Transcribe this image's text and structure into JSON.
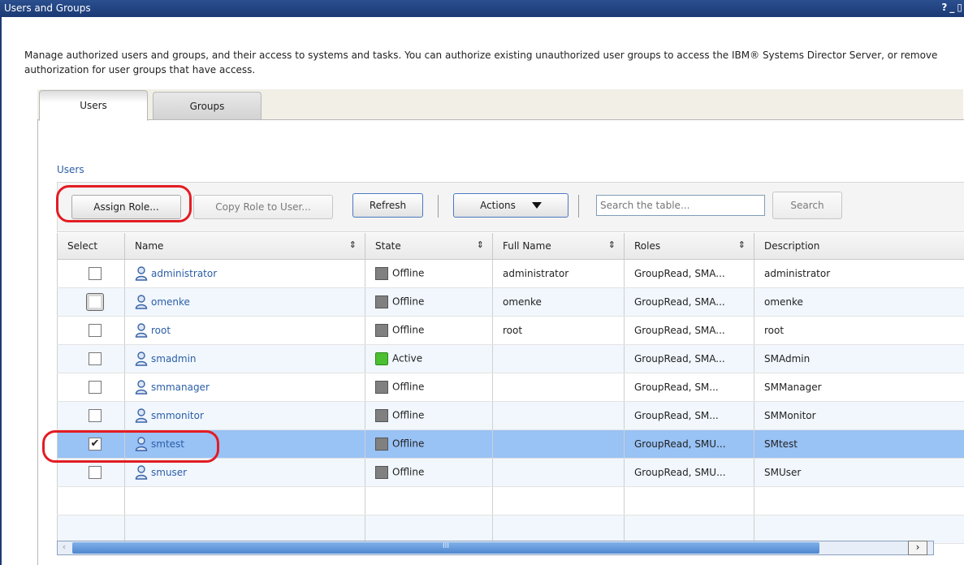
{
  "window": {
    "title": "Users and Groups",
    "help": "?",
    "minimize": "_"
  },
  "description": "Manage authorized users and groups, and their access to systems and tasks. You can authorize existing unauthorized user groups to access the IBM® Systems Director Server, or remove authorization for user groups that have access.",
  "tabs": [
    {
      "label": "Users"
    },
    {
      "label": "Groups"
    }
  ],
  "section_label": "Users",
  "toolbar": {
    "assign_role": "Assign Role...",
    "copy_role": "Copy Role to User...",
    "refresh": "Refresh",
    "actions": "Actions",
    "search_placeholder": "Search the table...",
    "search": "Search"
  },
  "table": {
    "columns": [
      "Select",
      "Name",
      "State",
      "Full Name",
      "Roles",
      "Description"
    ],
    "rows": [
      {
        "name": "administrator",
        "state": "Offline",
        "full_name": "administrator",
        "roles": "GroupRead, SMA...",
        "description": "administrator",
        "checked": "",
        "status": "offline"
      },
      {
        "name": "omenke",
        "state": "Offline",
        "full_name": "omenke",
        "roles": "GroupRead, SMA...",
        "description": "omenke",
        "checked": "",
        "status": "offline"
      },
      {
        "name": "root",
        "state": "Offline",
        "full_name": "root",
        "roles": "GroupRead, SMA...",
        "description": "root",
        "checked": "",
        "status": "offline"
      },
      {
        "name": "smadmin",
        "state": "Active",
        "full_name": "",
        "roles": "GroupRead, SMA...",
        "description": "SMAdmin",
        "checked": "",
        "status": "active"
      },
      {
        "name": "smmanager",
        "state": "Offline",
        "full_name": "",
        "roles": "GroupRead, SM...",
        "description": "SMManager",
        "checked": "",
        "status": "offline"
      },
      {
        "name": "smmonitor",
        "state": "Offline",
        "full_name": "",
        "roles": "GroupRead, SM...",
        "description": "SMMonitor",
        "checked": "",
        "status": "offline"
      },
      {
        "name": "smtest",
        "state": "Offline",
        "full_name": "",
        "roles": "GroupRead, SMU...",
        "description": "SMtest",
        "checked": "✔",
        "status": "offline"
      },
      {
        "name": "smuser",
        "state": "Offline",
        "full_name": "",
        "roles": "GroupRead, SMU...",
        "description": "SMUser",
        "checked": "",
        "status": "offline"
      }
    ]
  },
  "scrollbar": {
    "grip": "III",
    "right_arrow": "›",
    "left_arrow": "‹"
  },
  "colors": {
    "titlebar": "#1b3a74",
    "link": "#2b5ea8",
    "selected_row": "#99c2f5",
    "highlight": "#e31c23",
    "active": "#4cbf32"
  },
  "icons": {
    "user": "user-icon",
    "offline": "offline-state-icon",
    "active": "active-state-icon",
    "sort": "sort-icon",
    "dropdown": "chevron-down-icon"
  }
}
